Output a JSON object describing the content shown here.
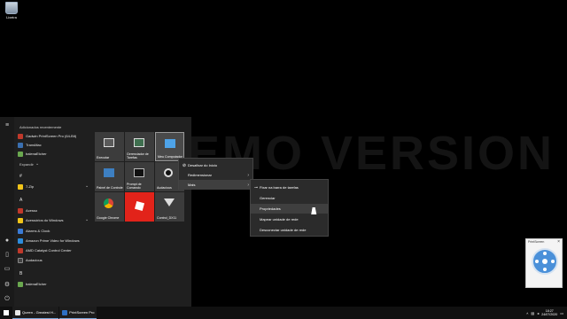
{
  "desktop": {
    "recycle_bin_label": "Lixeira",
    "watermark": "DEMO VERSION"
  },
  "start_menu": {
    "recent_title": "Adicionados recentemente",
    "expand_label": "Expandir",
    "recent_apps": [
      {
        "label": "Gadwin PrintScreen Pro (64-Bit)",
        "color": "#c0392b"
      },
      {
        "label": "TransMac",
        "color": "#3a6fb0"
      },
      {
        "label": "balenaEtcher",
        "color": "#6aa84f"
      }
    ],
    "letters": {
      "hash": "#",
      "a": "A",
      "b": "B"
    },
    "apps": [
      {
        "label": "7-Zip",
        "color": "#f0c419"
      },
      {
        "label": "Acesso",
        "color": "#c0392b"
      },
      {
        "label": "Acessórios do Windows",
        "color": "#f0c419"
      },
      {
        "label": "Alarms & Clock",
        "color": "#3a7bd5"
      },
      {
        "label": "Amazon Prime Video for Windows",
        "color": "#2d8cdc"
      },
      {
        "label": "AMD Catalyst Control Center",
        "color": "#c0392b"
      },
      {
        "label": "Audacious",
        "color": "#2b2b2b"
      },
      {
        "label": "balenaEtcher",
        "color": "#6aa84f"
      }
    ],
    "tiles": [
      {
        "label": "Executar",
        "icon": "run-icon"
      },
      {
        "label": "Gerenciador de Tarefas",
        "icon": "task-manager-icon"
      },
      {
        "label": "Meu Computador",
        "icon": "computer-icon"
      },
      {
        "label": "Painel de Controle",
        "icon": "control-panel-icon"
      },
      {
        "label": "Prompt de Comando",
        "icon": "command-prompt-icon"
      },
      {
        "label": "Audacious",
        "icon": "audacious-icon"
      },
      {
        "label": "Google Chrome",
        "icon": "chrome-icon"
      },
      {
        "label": "",
        "icon": "roblox-icon"
      },
      {
        "label": "Control_DX11",
        "icon": "control-dx11-icon"
      }
    ]
  },
  "context_menu": {
    "items": [
      {
        "label": "Desafixar do Início",
        "icon": "unpin-icon"
      },
      {
        "label": "Redimensionar",
        "icon": ""
      },
      {
        "label": "Mais",
        "icon": ""
      }
    ]
  },
  "submenu": {
    "items": [
      {
        "label": "Fixar na barra de tarefas",
        "icon": "pin-icon"
      },
      {
        "label": "Gerenciar"
      },
      {
        "label": "Propriedades"
      },
      {
        "label": "Mapear unidade de rede"
      },
      {
        "label": "Desconectar unidade de rede"
      }
    ]
  },
  "widget": {
    "title": "PrintScreen"
  },
  "taskbar": {
    "apps": [
      {
        "label": "Queen - Greatest H...",
        "color": "#e8e8e8"
      },
      {
        "label": "PrintScreen Pro",
        "color": "#2d6fc4"
      }
    ],
    "time": "18:27",
    "date": "24/07/2020"
  }
}
